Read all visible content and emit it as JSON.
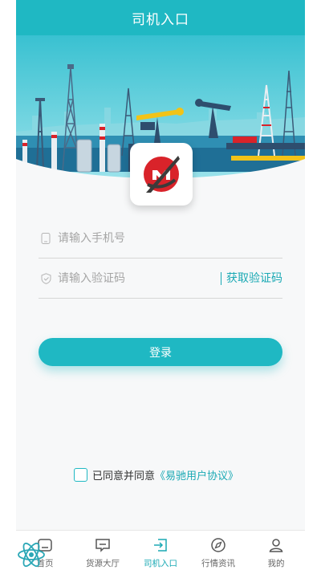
{
  "header": {
    "title": "司机入口"
  },
  "login_form": {
    "phone_placeholder": "请输入手机号",
    "code_placeholder": "请输入验证码",
    "get_code_label": "获取验证码",
    "login_label": "登录"
  },
  "agreement": {
    "prefix": "已同意并同意",
    "link": "《易驰用户协议》",
    "checked": false
  },
  "tabbar": {
    "items": [
      {
        "label": "首页",
        "icon": "home-icon"
      },
      {
        "label": "货源大厅",
        "icon": "cargo-icon"
      },
      {
        "label": "司机入口",
        "icon": "driver-entry-icon",
        "active": true
      },
      {
        "label": "行情资讯",
        "icon": "compass-icon"
      },
      {
        "label": "我的",
        "icon": "user-icon"
      }
    ]
  },
  "colors": {
    "accent": "#1fb8c3",
    "link": "#1aa9b4",
    "logo_red": "#d9232a"
  }
}
